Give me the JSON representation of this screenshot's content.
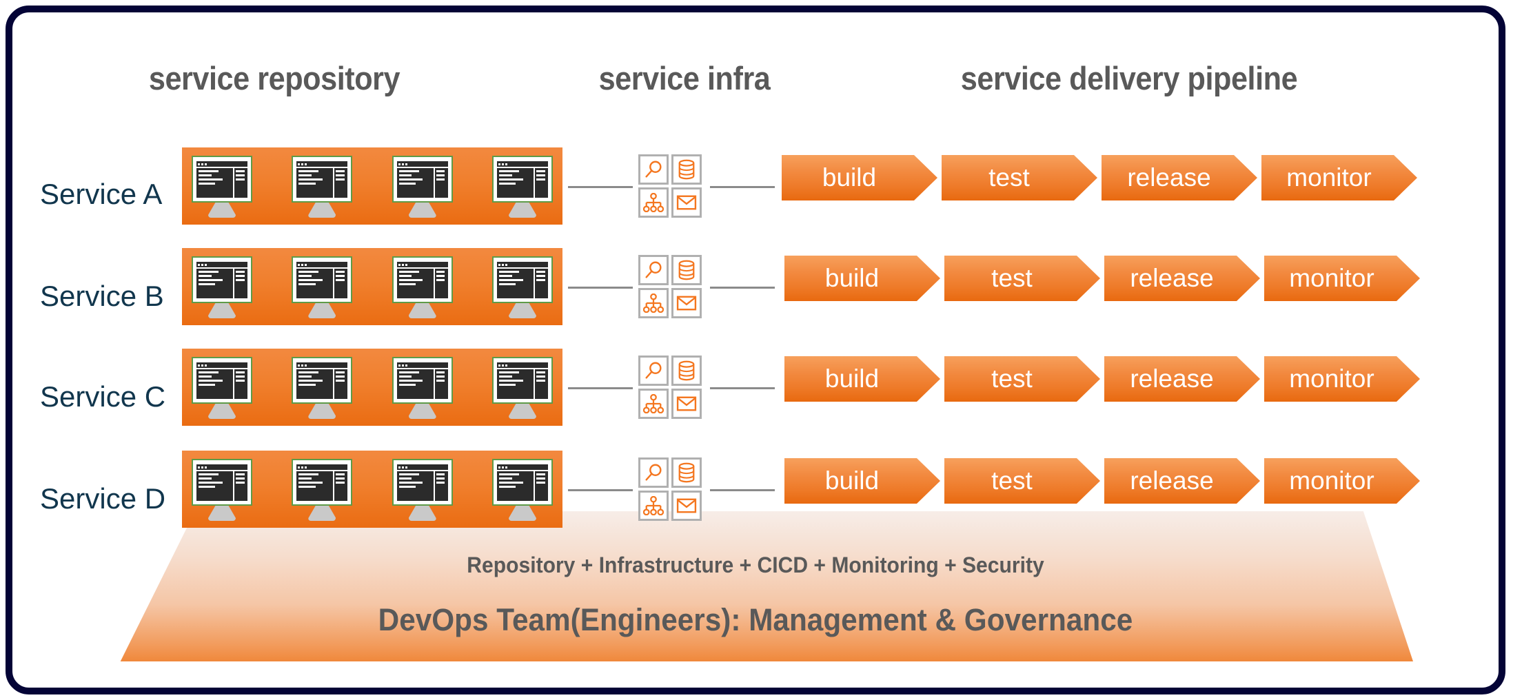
{
  "frame": {
    "border_color": "#040436"
  },
  "palette": {
    "orange_panel": "#ef7d2b",
    "orange_chevron_top": "#f7a05c",
    "orange_chevron_bottom": "#e8690f",
    "header_gray": "#595959",
    "service_label_navy": "#11364d",
    "monitor_border_green": "#5e9b48",
    "monitor_screen_dark": "#2b2b2b",
    "monitor_stand_gray": "#c9c9c9",
    "icon_orange": "#f4761f",
    "icon_box_border_gray": "#b0b0b0",
    "connector_gray": "#8a8a8a"
  },
  "headers": [
    {
      "id": "service-repository",
      "label": "service repository"
    },
    {
      "id": "service-infra",
      "label": "service infra"
    },
    {
      "id": "service-delivery-pipeline",
      "label": "service delivery pipeline"
    }
  ],
  "rows": [
    {
      "label": "Service A",
      "repository": {
        "monitor_count": 4,
        "monitor_label": "code editor screen"
      },
      "infra_icons": [
        {
          "name": "search-icon",
          "label": "search"
        },
        {
          "name": "database-icon",
          "label": "database"
        },
        {
          "name": "network-tree-icon",
          "label": "network"
        },
        {
          "name": "mail-icon",
          "label": "mail"
        }
      ],
      "pipeline": [
        "build",
        "test",
        "release",
        "monitor"
      ]
    },
    {
      "label": "Service B",
      "repository": {
        "monitor_count": 4,
        "monitor_label": "code editor screen"
      },
      "infra_icons": [
        {
          "name": "search-icon",
          "label": "search"
        },
        {
          "name": "database-icon",
          "label": "database"
        },
        {
          "name": "network-tree-icon",
          "label": "network"
        },
        {
          "name": "mail-icon",
          "label": "mail"
        }
      ],
      "pipeline": [
        "build",
        "test",
        "release",
        "monitor"
      ]
    },
    {
      "label": "Service C",
      "repository": {
        "monitor_count": 4,
        "monitor_label": "code editor screen"
      },
      "infra_icons": [
        {
          "name": "search-icon",
          "label": "search"
        },
        {
          "name": "database-icon",
          "label": "database"
        },
        {
          "name": "network-tree-icon",
          "label": "network"
        },
        {
          "name": "mail-icon",
          "label": "mail"
        }
      ],
      "pipeline": [
        "build",
        "test",
        "release",
        "monitor"
      ]
    },
    {
      "label": "Service D",
      "repository": {
        "monitor_count": 4,
        "monitor_label": "code editor screen"
      },
      "infra_icons": [
        {
          "name": "search-icon",
          "label": "search"
        },
        {
          "name": "database-icon",
          "label": "database"
        },
        {
          "name": "network-tree-icon",
          "label": "network"
        },
        {
          "name": "mail-icon",
          "label": "mail"
        }
      ],
      "pipeline": [
        "build",
        "test",
        "release",
        "monitor"
      ]
    }
  ],
  "foundation": {
    "line1": "Repository + Infrastructure + CICD + Monitoring + Security",
    "line2": "DevOps Team(Engineers): Management & Governance"
  }
}
